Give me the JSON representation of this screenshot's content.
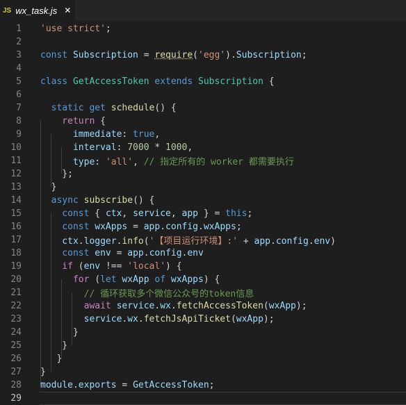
{
  "tab": {
    "icon_text": "JS",
    "title": "wx_task.js",
    "close_glyph": "✕"
  },
  "current_line": 29,
  "lines": [
    {
      "n": "1",
      "tokens": [
        {
          "t": "'use strict'",
          "c": "str"
        },
        {
          "t": ";",
          "c": "punc"
        }
      ]
    },
    {
      "n": "2",
      "tokens": []
    },
    {
      "n": "3",
      "tokens": [
        {
          "t": "const ",
          "c": "kw"
        },
        {
          "t": "Subscription",
          "c": "var"
        },
        {
          "t": " = ",
          "c": "punc"
        },
        {
          "t": "require",
          "c": "fn squiggle"
        },
        {
          "t": "(",
          "c": "punc"
        },
        {
          "t": "'egg'",
          "c": "str"
        },
        {
          "t": ").",
          "c": "punc"
        },
        {
          "t": "Subscription",
          "c": "var"
        },
        {
          "t": ";",
          "c": "punc"
        }
      ]
    },
    {
      "n": "4",
      "tokens": []
    },
    {
      "n": "5",
      "tokens": [
        {
          "t": "class ",
          "c": "kw"
        },
        {
          "t": "GetAccessToken",
          "c": "cls"
        },
        {
          "t": " extends ",
          "c": "kw"
        },
        {
          "t": "Subscription",
          "c": "cls"
        },
        {
          "t": " {",
          "c": "punc"
        }
      ]
    },
    {
      "n": "6",
      "tokens": []
    },
    {
      "n": "7",
      "tokens": [
        {
          "t": "  static ",
          "c": "kw"
        },
        {
          "t": "get ",
          "c": "kw"
        },
        {
          "t": "schedule",
          "c": "fn"
        },
        {
          "t": "() {",
          "c": "punc"
        }
      ]
    },
    {
      "n": "8",
      "tokens": [
        {
          "t": "    return",
          "c": "kw2"
        },
        {
          "t": " {",
          "c": "punc"
        }
      ]
    },
    {
      "n": "9",
      "tokens": [
        {
          "t": "      immediate",
          "c": "var"
        },
        {
          "t": ": ",
          "c": "punc"
        },
        {
          "t": "true",
          "c": "kw"
        },
        {
          "t": ",",
          "c": "punc"
        }
      ]
    },
    {
      "n": "10",
      "tokens": [
        {
          "t": "      interval",
          "c": "var"
        },
        {
          "t": ": ",
          "c": "punc"
        },
        {
          "t": "7000",
          "c": "num"
        },
        {
          "t": " * ",
          "c": "punc"
        },
        {
          "t": "1000",
          "c": "num"
        },
        {
          "t": ",",
          "c": "punc"
        }
      ]
    },
    {
      "n": "11",
      "tokens": [
        {
          "t": "      type",
          "c": "var"
        },
        {
          "t": ": ",
          "c": "punc"
        },
        {
          "t": "'all'",
          "c": "str"
        },
        {
          "t": ", ",
          "c": "punc"
        },
        {
          "t": "// 指定所有的 worker 都需要执行",
          "c": "cmt"
        }
      ]
    },
    {
      "n": "12",
      "tokens": [
        {
          "t": "    };",
          "c": "punc"
        }
      ]
    },
    {
      "n": "13",
      "tokens": [
        {
          "t": "  }",
          "c": "punc"
        }
      ]
    },
    {
      "n": "14",
      "tokens": [
        {
          "t": "  async ",
          "c": "kw"
        },
        {
          "t": "subscribe",
          "c": "fn"
        },
        {
          "t": "() {",
          "c": "punc"
        }
      ]
    },
    {
      "n": "15",
      "tokens": [
        {
          "t": "    const ",
          "c": "kw"
        },
        {
          "t": "{ ",
          "c": "punc"
        },
        {
          "t": "ctx",
          "c": "var"
        },
        {
          "t": ", ",
          "c": "punc"
        },
        {
          "t": "service",
          "c": "var"
        },
        {
          "t": ", ",
          "c": "punc"
        },
        {
          "t": "app",
          "c": "var"
        },
        {
          "t": " } = ",
          "c": "punc"
        },
        {
          "t": "this",
          "c": "kw"
        },
        {
          "t": ";",
          "c": "punc"
        }
      ]
    },
    {
      "n": "16",
      "tokens": [
        {
          "t": "    const ",
          "c": "kw"
        },
        {
          "t": "wxApps",
          "c": "var"
        },
        {
          "t": " = ",
          "c": "punc"
        },
        {
          "t": "app",
          "c": "var"
        },
        {
          "t": ".",
          "c": "punc"
        },
        {
          "t": "config",
          "c": "var"
        },
        {
          "t": ".",
          "c": "punc"
        },
        {
          "t": "wxApps",
          "c": "var"
        },
        {
          "t": ";",
          "c": "punc"
        }
      ]
    },
    {
      "n": "17",
      "tokens": [
        {
          "t": "    ctx",
          "c": "var"
        },
        {
          "t": ".",
          "c": "punc"
        },
        {
          "t": "logger",
          "c": "var"
        },
        {
          "t": ".",
          "c": "punc"
        },
        {
          "t": "info",
          "c": "fn"
        },
        {
          "t": "(",
          "c": "punc"
        },
        {
          "t": "'【项目运行环境】:'",
          "c": "str"
        },
        {
          "t": " + ",
          "c": "punc"
        },
        {
          "t": "app",
          "c": "var"
        },
        {
          "t": ".",
          "c": "punc"
        },
        {
          "t": "config",
          "c": "var"
        },
        {
          "t": ".",
          "c": "punc"
        },
        {
          "t": "env",
          "c": "var"
        },
        {
          "t": ")",
          "c": "punc"
        }
      ]
    },
    {
      "n": "18",
      "tokens": [
        {
          "t": "    const ",
          "c": "kw"
        },
        {
          "t": "env",
          "c": "var"
        },
        {
          "t": " = ",
          "c": "punc"
        },
        {
          "t": "app",
          "c": "var"
        },
        {
          "t": ".",
          "c": "punc"
        },
        {
          "t": "config",
          "c": "var"
        },
        {
          "t": ".",
          "c": "punc"
        },
        {
          "t": "env",
          "c": "var"
        }
      ]
    },
    {
      "n": "19",
      "tokens": [
        {
          "t": "    if",
          "c": "kw2"
        },
        {
          "t": " (",
          "c": "punc"
        },
        {
          "t": "env",
          "c": "var"
        },
        {
          "t": " !== ",
          "c": "punc"
        },
        {
          "t": "'local'",
          "c": "str"
        },
        {
          "t": ") {",
          "c": "punc"
        }
      ]
    },
    {
      "n": "20",
      "tokens": [
        {
          "t": "      for",
          "c": "kw2"
        },
        {
          "t": " (",
          "c": "punc"
        },
        {
          "t": "let ",
          "c": "kw"
        },
        {
          "t": "wxApp",
          "c": "var"
        },
        {
          "t": " of ",
          "c": "kw"
        },
        {
          "t": "wxApps",
          "c": "var"
        },
        {
          "t": ") {",
          "c": "punc"
        }
      ]
    },
    {
      "n": "21",
      "tokens": [
        {
          "t": "        // 循环获取多个微信公众号的token信息",
          "c": "cmt"
        }
      ]
    },
    {
      "n": "22",
      "tokens": [
        {
          "t": "        await ",
          "c": "kw2"
        },
        {
          "t": "service",
          "c": "var"
        },
        {
          "t": ".",
          "c": "punc"
        },
        {
          "t": "wx",
          "c": "var"
        },
        {
          "t": ".",
          "c": "punc"
        },
        {
          "t": "fetchAccessToken",
          "c": "fn"
        },
        {
          "t": "(",
          "c": "punc"
        },
        {
          "t": "wxApp",
          "c": "var"
        },
        {
          "t": ");",
          "c": "punc"
        }
      ]
    },
    {
      "n": "23",
      "tokens": [
        {
          "t": "        service",
          "c": "var"
        },
        {
          "t": ".",
          "c": "punc"
        },
        {
          "t": "wx",
          "c": "var"
        },
        {
          "t": ".",
          "c": "punc"
        },
        {
          "t": "fetchJsApiTicket",
          "c": "fn"
        },
        {
          "t": "(",
          "c": "punc"
        },
        {
          "t": "wxApp",
          "c": "var"
        },
        {
          "t": ");",
          "c": "punc"
        }
      ]
    },
    {
      "n": "24",
      "tokens": [
        {
          "t": "      }",
          "c": "punc"
        }
      ]
    },
    {
      "n": "25",
      "tokens": [
        {
          "t": "    }",
          "c": "punc"
        }
      ]
    },
    {
      "n": "26",
      "tokens": [
        {
          "t": "   }",
          "c": "punc"
        }
      ]
    },
    {
      "n": "27",
      "tokens": [
        {
          "t": "}",
          "c": "punc"
        }
      ]
    },
    {
      "n": "28",
      "tokens": [
        {
          "t": "module",
          "c": "var"
        },
        {
          "t": ".",
          "c": "punc"
        },
        {
          "t": "exports",
          "c": "var"
        },
        {
          "t": " = ",
          "c": "punc"
        },
        {
          "t": "GetAccessToken",
          "c": "var"
        },
        {
          "t": ";",
          "c": "punc"
        }
      ]
    },
    {
      "n": "29",
      "tokens": []
    }
  ]
}
